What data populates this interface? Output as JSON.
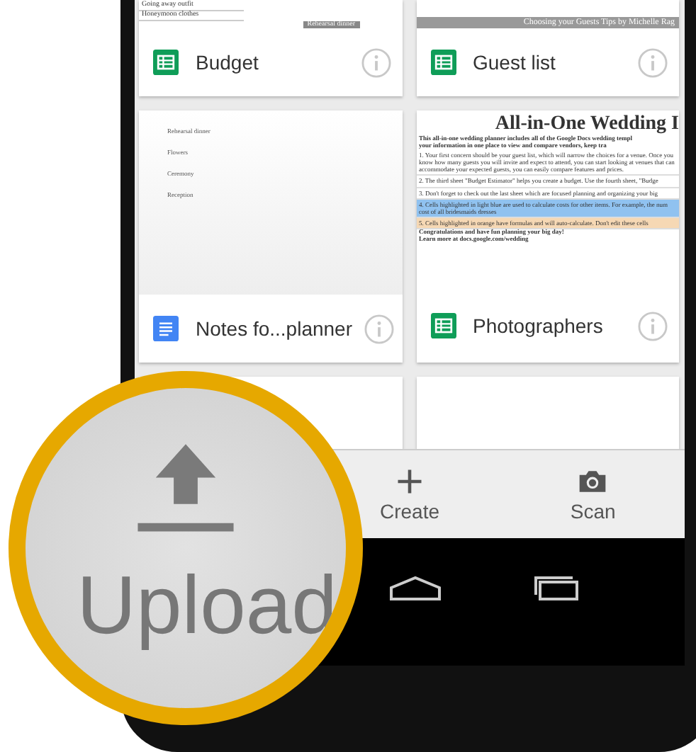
{
  "cards": [
    {
      "title": "Budget",
      "kind": "sheet",
      "preview": [
        {
          "kind": "plain",
          "text": "Going away outfit"
        },
        {
          "kind": "plain",
          "text": "Honeymoon clothes"
        },
        {
          "kind": "tag",
          "text": "Rehearsal dinner"
        }
      ]
    },
    {
      "title": "Guest list",
      "kind": "sheet",
      "preview": [
        {
          "kind": "banner",
          "text": "Choosing your Guests Tips by Michelle Rag"
        }
      ]
    },
    {
      "title": "Notes fo...planner",
      "kind": "doc",
      "preview": [
        {
          "kind": "note",
          "text": "Rehearsal dinner"
        },
        {
          "kind": "note",
          "text": "Flowers"
        },
        {
          "kind": "note",
          "text": "Ceremony"
        },
        {
          "kind": "note",
          "text": "Reception"
        }
      ]
    },
    {
      "title": "Photographers",
      "kind": "sheet",
      "preview": [
        {
          "kind": "title",
          "text": "All-in-One Wedding I"
        },
        {
          "kind": "bold",
          "text": "This all-in-one wedding planner includes all of the Google Docs wedding templ"
        },
        {
          "kind": "bold",
          "text": "your information in one place to view and compare vendors, keep tra"
        },
        {
          "kind": "plain",
          "text": "1. Your first concern should be your guest list, which will narrow the choices for a venue. Once you know how many guests you will invite and expect to attend, you can start looking at venues that can accommodate your expected guests, you can easily compare features and prices."
        },
        {
          "kind": "plain",
          "text": "2. The third sheet \"Budget Estimator\" helps you create a budget.  Use the fourth sheet, \"Budge"
        },
        {
          "kind": "plain",
          "text": "3. Don't forget to check out the last sheet which are focused planning and organizing your big"
        },
        {
          "kind": "blue",
          "text": "4. Cells highlighted in light blue are used to calculate costs for other items. For example, the num cost of all bridesmaids dresses"
        },
        {
          "kind": "orange",
          "text": "5. Cells highlighted in orange have formulas and will auto-calculate. Don't edit these cells"
        },
        {
          "kind": "bold",
          "text": "Congratulations and have fun planning your big day!"
        },
        {
          "kind": "bold",
          "text": "Learn more at docs.google.com/wedding"
        }
      ]
    },
    {
      "kind": "blank"
    },
    {
      "kind": "blank"
    }
  ],
  "actions": [
    {
      "label": "Create",
      "kind": "create"
    },
    {
      "label": "Scan",
      "kind": "scan"
    }
  ],
  "magnifier": {
    "label": "Upload"
  }
}
